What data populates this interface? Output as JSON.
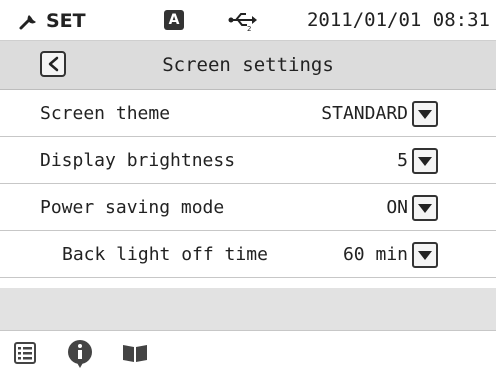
{
  "statusbar": {
    "mode_label": "SET",
    "mode_icon": "wrench-icon",
    "input_badge": "A",
    "usb_icon": "usb-icon",
    "datetime": "2011/01/01 08:31"
  },
  "header": {
    "title": "Screen settings",
    "back_icon": "chevron-left-icon"
  },
  "settings": [
    {
      "label": "Screen theme",
      "value": "STANDARD"
    },
    {
      "label": "Display brightness",
      "value": "5"
    },
    {
      "label": "Power saving mode",
      "value": "ON"
    },
    {
      "label": "Back light off time",
      "value": "60 min"
    }
  ],
  "footer": {
    "icons": [
      "list-icon",
      "info-icon",
      "book-icon"
    ]
  },
  "colors": {
    "header_bg": "#dcdcdc",
    "empty_bg": "#e2e2e2",
    "text": "#222222"
  }
}
